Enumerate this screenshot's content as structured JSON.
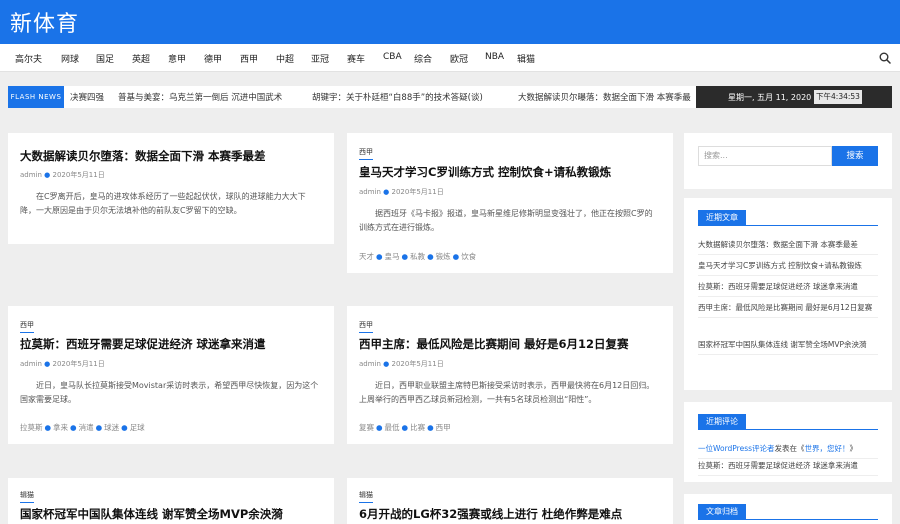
{
  "site": {
    "logo": "新体育"
  },
  "nav": {
    "items": [
      "高尔夫",
      "网球",
      "国足",
      "英超",
      "意甲",
      "德甲",
      "西甲",
      "中超",
      "亚冠",
      "赛车",
      "CBA",
      "综合",
      "欧冠",
      "NBA",
      "辑猫"
    ]
  },
  "flash": {
    "label": "FLASH NEWS",
    "items": [
      "决赛四强",
      "普基与美宴：乌克兰第一倒后  沉进中国武术",
      "胡键宇：关于朴廷桓“白88手”的技术答疑(谈)",
      "大数据解读贝尔曝落：数据全面下滑  本赛季最"
    ],
    "date": "星期一, 五月 11, 2020",
    "time": "下午4:34:53"
  },
  "posts": [
    {
      "category": "",
      "title": "大数据解读贝尔堕落：数据全面下滑  本赛季最差",
      "author": "admin",
      "date": "2020年5月11日",
      "excerpt": "在C罗离开后，皇马的进攻体系经历了一些起起伏伏，球队的进球能力大大下降，一大原因是由于贝尔无法填补他的前队友C罗留下的空缺。",
      "tags": []
    },
    {
      "category": "西甲",
      "title": "皇马天才学习C罗训练方式  控制饮食+请私教锻炼",
      "author": "admin",
      "date": "2020年5月11日",
      "excerpt": "据西班牙《马卡报》报道，皇马新星维尼修斯明显变强壮了，他正在按照C罗的训练方式在进行锻炼。",
      "tags": [
        "天才",
        "皇马",
        "私教",
        "锻炼",
        "饮食"
      ]
    },
    {
      "category": "西甲",
      "title": "拉莫斯：西班牙需要足球促进经济  球迷拿来消遣",
      "author": "admin",
      "date": "2020年5月11日",
      "excerpt": "近日，皇马队长拉莫斯接受Movistar采访时表示，希望西甲尽快恢复，因为这个国家需要足球。",
      "tags": [
        "拉莫斯",
        "拿来",
        "消遣",
        "球迷",
        "足球"
      ]
    },
    {
      "category": "西甲",
      "title": "西甲主席：最低风险是比赛期间  最好是6月12日复赛",
      "author": "admin",
      "date": "2020年5月11日",
      "excerpt": "近日，西甲职业联盟主席特巴斯接受采访时表示，西甲最快将在6月12日回归。上周举行的西甲西乙球员新冠检测，一共有5名球员检测出“阳性”。",
      "tags": [
        "复赛",
        "最低",
        "比赛",
        "西甲"
      ]
    },
    {
      "category": "辑猫",
      "title": "国家杯冠军中国队集体连线  谢军赞全场MVP余泱漪",
      "author": "",
      "date": "",
      "excerpt": "",
      "tags": []
    },
    {
      "category": "辑猫",
      "title": "6月开战的LG杯32强赛或线上进行  杜绝作弊是难点",
      "author": "",
      "date": "",
      "excerpt": "",
      "tags": []
    }
  ],
  "sidebar": {
    "search_placeholder": "搜索...",
    "search_button": "搜索",
    "recent_title": "近期文章",
    "recent": [
      "大数据解读贝尔堕落：数据全面下滑  本赛季最差",
      "皇马天才学习C罗训练方式  控制饮食+请私教锻炼",
      "拉莫斯：西班牙需要足球促进经济  球迷拿来消遣",
      "西甲主席：最低风险是比赛期间  最好是6月12日复赛",
      "国家杯冠军中国队集体连线  谢军赞全场MVP余泱漪"
    ],
    "comments_title": "近期评论",
    "comment": {
      "author": "一位WordPress评论者",
      "mid": "发表在《",
      "post": "世界，您好！",
      "end": "》"
    },
    "comment_post2": "拉莫斯：西班牙需要足球促进经济  球迷拿来消遣",
    "archive_title": "文章归档"
  },
  "colors": {
    "accent": "#1a73e8",
    "datebar": "#2b2b2b"
  }
}
